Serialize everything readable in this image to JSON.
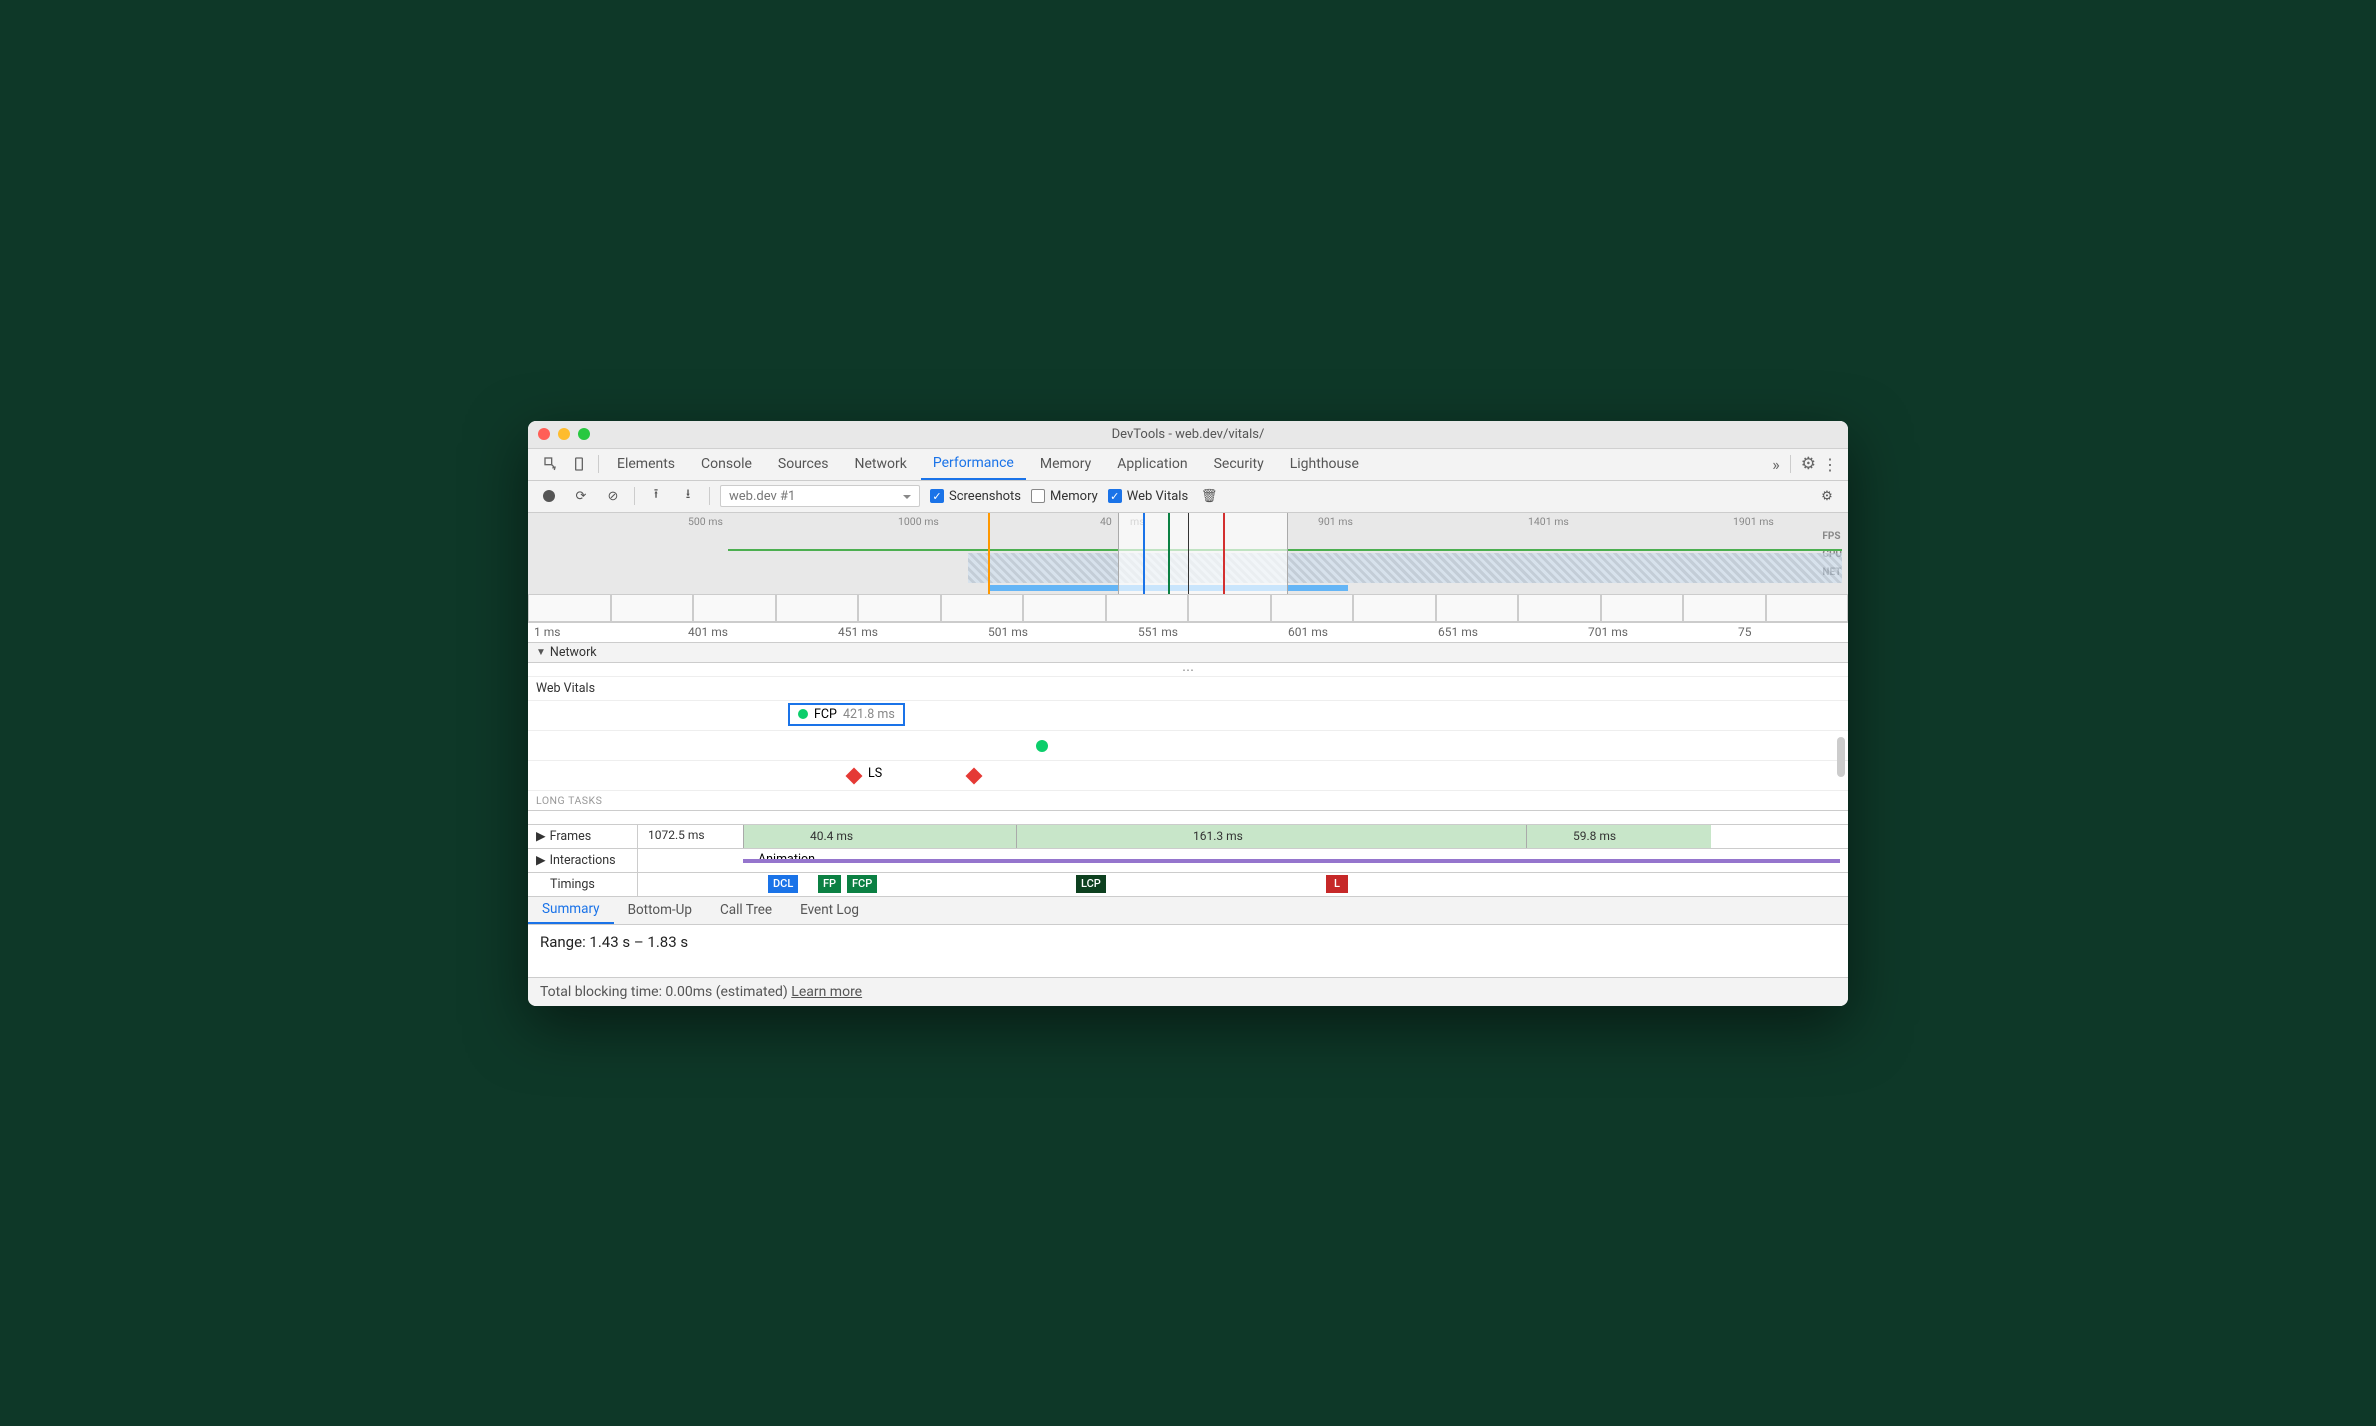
{
  "window": {
    "title": "DevTools - web.dev/vitals/"
  },
  "tabs": {
    "items": [
      "Elements",
      "Console",
      "Sources",
      "Network",
      "Performance",
      "Memory",
      "Application",
      "Security",
      "Lighthouse"
    ],
    "active": "Performance",
    "more": "»"
  },
  "toolbar": {
    "select": "web.dev #1",
    "screenshots": {
      "label": "Screenshots",
      "checked": true
    },
    "memory": {
      "label": "Memory",
      "checked": false
    },
    "webvitals": {
      "label": "Web Vitals",
      "checked": true
    }
  },
  "overview": {
    "ticks": [
      "500 ms",
      "1000 ms",
      "40",
      "ms",
      "901 ms",
      "1401 ms",
      "1901 ms"
    ],
    "labels": [
      "FPS",
      "CPU",
      "NET"
    ]
  },
  "ruler": [
    "1 ms",
    "401 ms",
    "451 ms",
    "501 ms",
    "551 ms",
    "601 ms",
    "651 ms",
    "701 ms",
    "75"
  ],
  "sections": {
    "network": "Network",
    "webvitals_head": "Web Vitals",
    "fcp": {
      "name": "FCP",
      "value": "421.8 ms"
    },
    "ls": "LS",
    "longtasks": "LONG TASKS",
    "frames": {
      "label": "Frames",
      "values": [
        "1072.5 ms",
        "40.4 ms",
        "161.3 ms",
        "59.8 ms"
      ]
    },
    "interactions": {
      "label": "Interactions",
      "anim": "Animation"
    },
    "timings": {
      "label": "Timings",
      "marks": [
        "DCL",
        "FP",
        "FCP",
        "LCP",
        "L"
      ]
    }
  },
  "detail": {
    "tabs": [
      "Summary",
      "Bottom-Up",
      "Call Tree",
      "Event Log"
    ],
    "active": "Summary",
    "range": "Range: 1.43 s – 1.83 s"
  },
  "footer": {
    "tbt": "Total blocking time: 0.00ms (estimated)",
    "learn": "Learn more"
  }
}
